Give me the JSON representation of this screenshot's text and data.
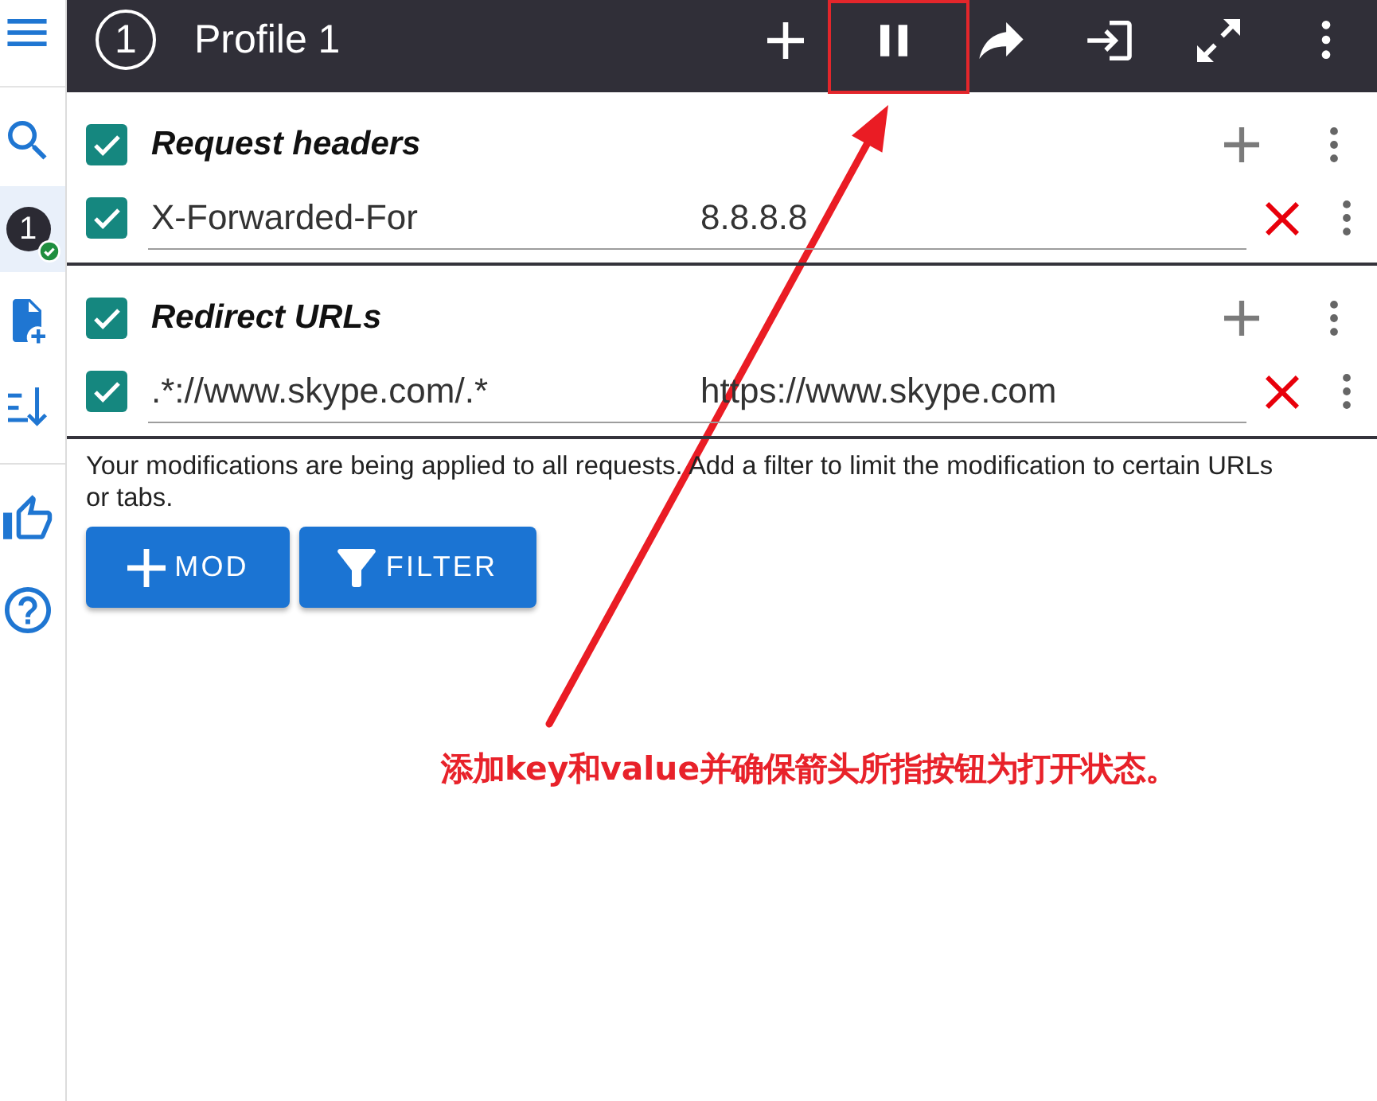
{
  "sidebar": {
    "profiles": [
      {
        "number": "1",
        "selected": true,
        "running": true
      }
    ]
  },
  "header": {
    "profile_number": "1",
    "title": "Profile 1",
    "paused": false
  },
  "sections": [
    {
      "title": "Request headers",
      "enabled": true,
      "rows": [
        {
          "enabled": true,
          "name": "X-Forwarded-For",
          "value": "8.8.8.8"
        }
      ]
    },
    {
      "title": "Redirect URLs",
      "enabled": true,
      "rows": [
        {
          "enabled": true,
          "name": ".*://www.skype.com/.*",
          "value": "https://www.skype.com"
        }
      ]
    }
  ],
  "notice": "Your modifications are being applied to all requests. Add a filter to limit the modification to certain URLs or tabs.",
  "buttons": [
    {
      "kind": "mod",
      "label": "MOD"
    },
    {
      "kind": "filter",
      "label": "FILTER"
    }
  ],
  "annotation": {
    "text": "添加key和value并确保箭头所指按钮为打开状态。"
  }
}
